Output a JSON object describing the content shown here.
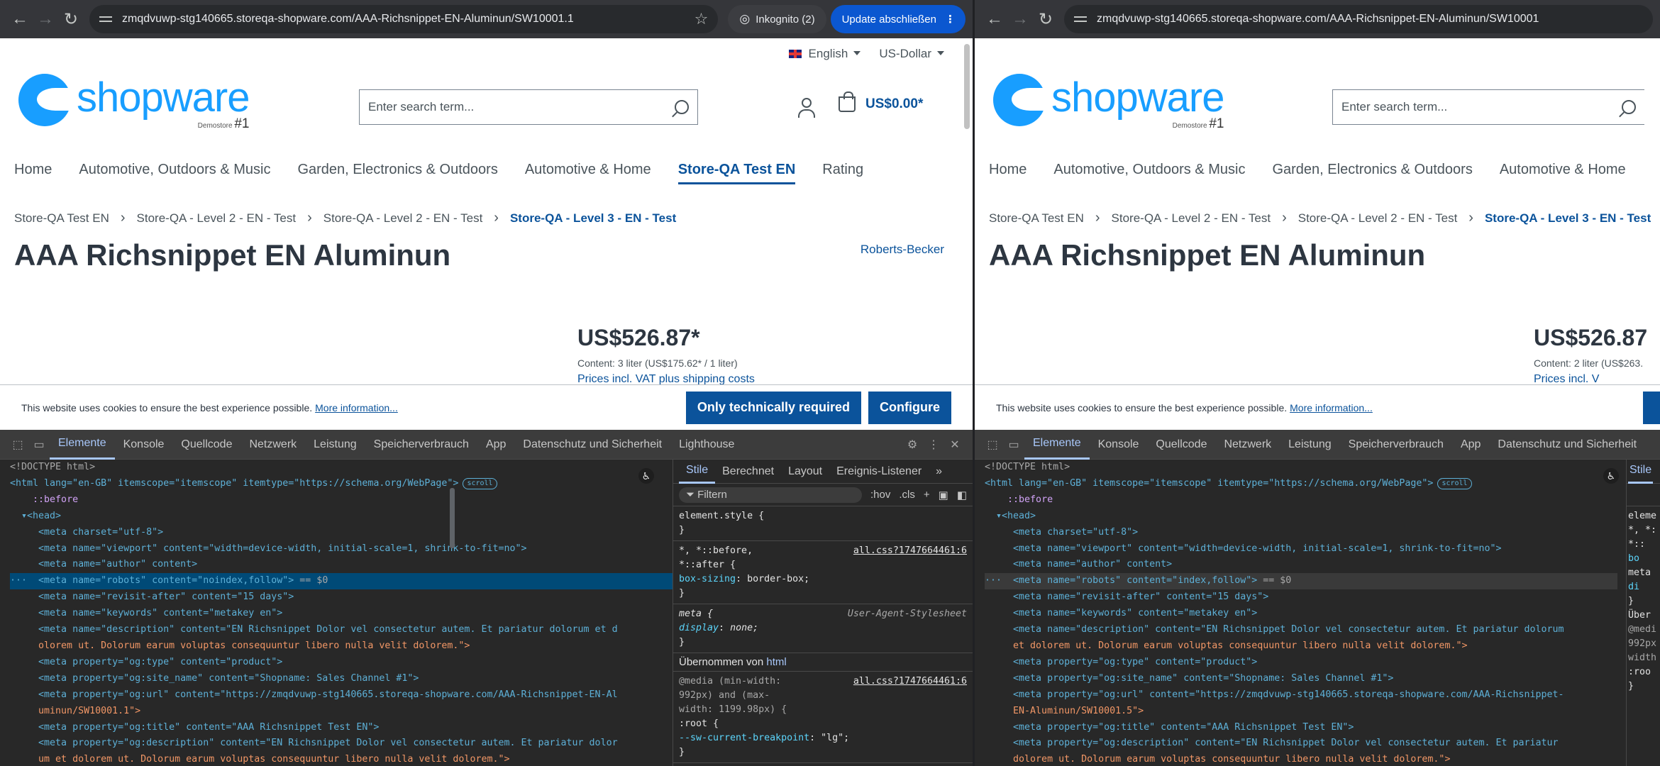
{
  "left": {
    "url": "zmqdvuwp-stg140665.storeqa-shopware.com/AAA-Richsnippet-EN-Aluminun/SW10001.1",
    "incognito": "Inkognito (2)",
    "update": "Update abschließen",
    "language": "English",
    "currency": "US-Dollar",
    "search_placeholder": "Enter search term...",
    "cart_total": "US$0.00*",
    "price": "US$526.87*",
    "content": "Content: 3 liter (US$175.62* / 1 liter)",
    "vat": "Prices incl. VAT plus shipping costs",
    "manufacturer": "Roberts-Becker",
    "cookie_text": "This website uses cookies to ensure the best experience possible.",
    "cookie_more": "More information...",
    "cookie_btn1": "Only technically required",
    "cookie_btn2": "Configure"
  },
  "right": {
    "url": "zmqdvuwp-stg140665.storeqa-shopware.com/AAA-Richsnippet-EN-Aluminun/SW10001",
    "search_placeholder": "Enter search term...",
    "price": "US$526.87",
    "content": "Content: 2 liter (US$263.",
    "vat": "Prices incl. V",
    "cookie_text": "This website uses cookies to ensure the best experience possible.",
    "cookie_more": "More information..."
  },
  "logo": {
    "word": "shopware",
    "sub": "Demostore",
    "num": "#1"
  },
  "nav": [
    "Home",
    "Automotive, Outdoors & Music",
    "Garden, Electronics & Outdoors",
    "Automotive & Home",
    "Store-QA Test EN",
    "Rating"
  ],
  "breadcrumb": [
    "Store-QA Test EN",
    "Store-QA - Level 2 - EN - Test",
    "Store-QA - Level 2 - EN - Test",
    "Store-QA - Level 3 - EN - Test"
  ],
  "product_title": "AAA Richsnippet EN Aluminun",
  "devtools_tabs": [
    "Elemente",
    "Konsole",
    "Quellcode",
    "Netzwerk",
    "Leistung",
    "Speicherverbrauch",
    "App",
    "Datenschutz und Sicherheit",
    "Lighthouse"
  ],
  "styles_tabs": [
    "Stile",
    "Berechnet",
    "Layout",
    "Ereignis-Listener"
  ],
  "styles": {
    "filter": "Filtern",
    "hov": ":hov",
    "cls": ".cls",
    "element_style": "element.style {",
    "close": "}",
    "universal_sel": "*, *::before,",
    "universal_sel2": "*::after {",
    "src": "all.css?1747664461:6",
    "box_sizing_prop": "box-sizing",
    "box_sizing_val": "border-box;",
    "meta_sel": "meta {",
    "ua": "User-Agent-Stylesheet",
    "display_prop": "display",
    "display_val": "none;",
    "inherited": "Übernommen von",
    "inherited_tag": "html",
    "media1": "@media (min-width:",
    "media2": "992px) and (max-",
    "media3": "width: 1199.98px) {",
    "root_sel": ":root {",
    "bp_prop": "--sw-current-breakpoint",
    "bp_val": "\"lg\";"
  },
  "code_left": {
    "doctype": "<!DOCTYPE html>",
    "html_open": "<html lang=\"en-GB\" itemscope=\"itemscope\" itemtype=\"https://schema.org/WebPage\">",
    "scroll_badge": "scroll",
    "before": "::before",
    "head": "<head>",
    "charset": "<meta charset=\"utf-8\">",
    "viewport": "<meta name=\"viewport\" content=\"width=device-width, initial-scale=1, shrink-to-fit=no\">",
    "author": "<meta name=\"author\" content>",
    "robots": "<meta name=\"robots\" content=\"noindex,follow\">",
    "robots_marker": "== $0",
    "revisit": "<meta name=\"revisit-after\" content=\"15 days\">",
    "keywords": "<meta name=\"keywords\" content=\"metakey en\">",
    "description_a": "<meta name=\"description\" content=\"EN Richsnippet Dolor vel consectetur autem. Et pariatur dolorum et d",
    "description_b": "olorem ut. Dolorum earum voluptas consequuntur libero nulla velit dolorem.\">",
    "og_type": "<meta property=\"og:type\" content=\"product\">",
    "og_site": "<meta property=\"og:site_name\" content=\"Shopname: Sales Channel #1\">",
    "og_url_a": "<meta property=\"og:url\" content=\"https://zmqdvuwp-stg140665.storeqa-shopware.com/AAA-Richsnippet-EN-Al",
    "og_url_b": "uminun/SW10001.1\">",
    "og_title": "<meta property=\"og:title\" content=\"AAA Richsnippet Test EN\">",
    "og_desc_a": "<meta property=\"og:description\" content=\"EN Richsnippet Dolor vel consectetur autem. Et pariatur dolor",
    "og_desc_b": "um et dolorem ut. Dolorum earum voluptas consequuntur libero nulla velit dolorem.\">"
  },
  "code_right": {
    "robots": "<meta name=\"robots\" content=\"index,follow\">",
    "description_a": "<meta name=\"description\" content=\"EN Richsnippet Dolor vel consectetur autem. Et pariatur dolorum",
    "description_b": "et dolorem ut. Dolorum earum voluptas consequuntur libero nulla velit dolorem.\">",
    "og_url_a": "<meta property=\"og:url\" content=\"https://zmqdvuwp-stg140665.storeqa-shopware.com/AAA-Richsnippet-",
    "og_url_b": "EN-Aluminun/SW10001.5\">",
    "og_desc_a": "<meta property=\"og:description\" content=\"EN Richsnippet Dolor vel consectetur autem. Et pariatur",
    "og_desc_b": "dolorem ut. Dolorum earum voluptas consequuntur libero nulla velit dolorem.\">",
    "styles_tab": "Stile",
    "style_frag1": "eleme",
    "style_frag2": "*, *:",
    "style_frag3": "*::",
    "style_frag4": "bo",
    "style_frag5": "meta",
    "style_frag6": "di",
    "style_frag7": "}",
    "style_frag8": "Über",
    "style_frag9": "@medi",
    "style_frag10": "992px",
    "style_frag11": "width",
    "style_frag12": ":roo",
    "style_frag13": "}"
  },
  "colors": {
    "brand": "#189eff",
    "link": "#0b539b",
    "devtools_bg": "#282828",
    "selection": "#004a77"
  }
}
